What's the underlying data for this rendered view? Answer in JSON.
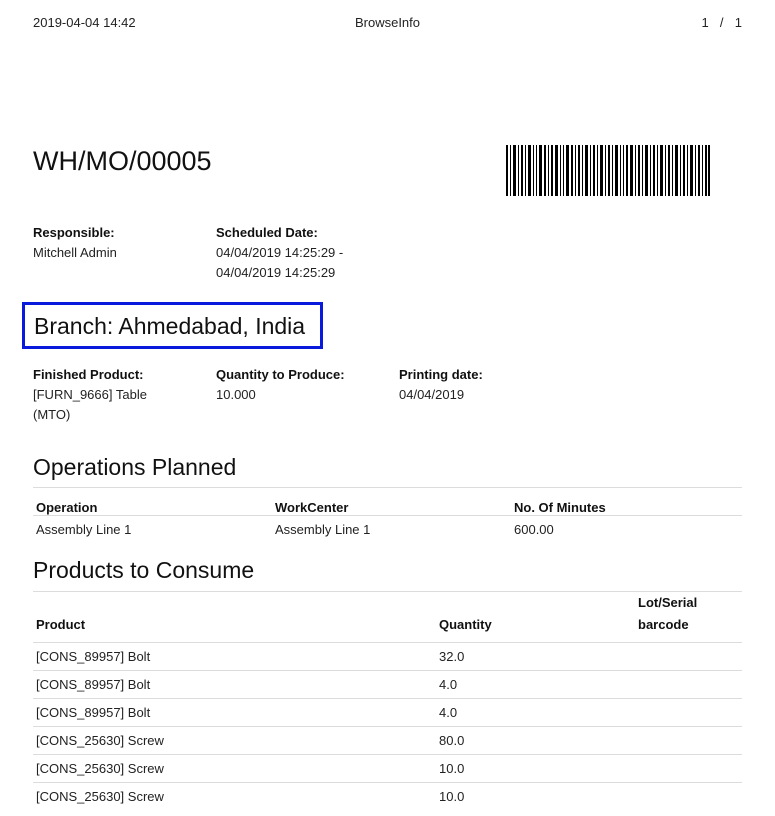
{
  "print_header": {
    "datetime": "2019-04-04 14:42",
    "app_title": "BrowseInfo",
    "page_indicator": "1  /  1"
  },
  "document": {
    "reference": "WH/MO/00005"
  },
  "responsible": {
    "label": "Responsible:",
    "value": "Mitchell Admin"
  },
  "scheduled_date": {
    "label": "Scheduled Date:",
    "line1": "04/04/2019 14:25:29 -",
    "line2": "04/04/2019 14:25:29"
  },
  "branch": {
    "text": "Branch: Ahmedabad, India",
    "highlight_color": "#0a1adc"
  },
  "finished_product": {
    "label": "Finished Product:",
    "line1": "[FURN_9666] Table",
    "line2": "(MTO)"
  },
  "quantity_to_produce": {
    "label": "Quantity to Produce:",
    "value": "10.000"
  },
  "printing_date": {
    "label": "Printing date:",
    "value": "04/04/2019"
  },
  "operations": {
    "title": "Operations Planned",
    "columns": [
      "Operation",
      "WorkCenter",
      "No. Of Minutes"
    ],
    "rows": [
      [
        "Assembly Line 1",
        "Assembly Line 1",
        "600.00"
      ]
    ]
  },
  "consume": {
    "title": "Products to Consume",
    "columns": [
      "Product",
      "Quantity",
      "Lot/Serial barcode"
    ],
    "rows": [
      [
        "[CONS_89957] Bolt",
        "32.0",
        ""
      ],
      [
        "[CONS_89957] Bolt",
        "4.0",
        ""
      ],
      [
        "[CONS_89957] Bolt",
        "4.0",
        ""
      ],
      [
        "[CONS_25630] Screw",
        "80.0",
        ""
      ],
      [
        "[CONS_25630] Screw",
        "10.0",
        ""
      ],
      [
        "[CONS_25630] Screw",
        "10.0",
        ""
      ]
    ]
  }
}
